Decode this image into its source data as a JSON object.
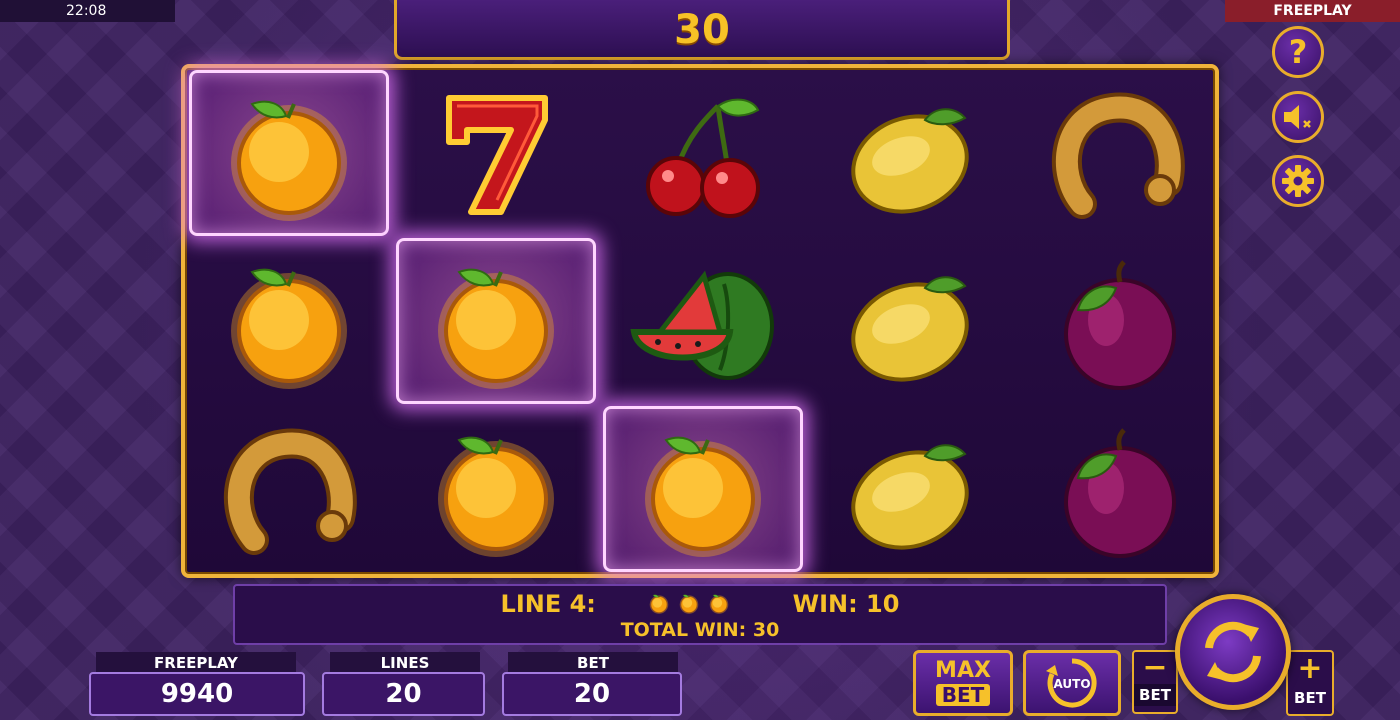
{
  "status": {
    "time": "22:08",
    "mode": "FREEPLAY"
  },
  "top_win": "30",
  "reels": [
    [
      "orange",
      "seven",
      "cherry",
      "lemon",
      "horseshoe"
    ],
    [
      "orange",
      "orange",
      "watermelon",
      "lemon",
      "plum"
    ],
    [
      "horseshoe",
      "orange",
      "orange",
      "lemon",
      "plum"
    ]
  ],
  "winning_cells": [
    [
      0,
      0
    ],
    [
      1,
      1
    ],
    [
      2,
      2
    ]
  ],
  "info": {
    "line_label": "LINE 4:",
    "win_label": "WIN: 10",
    "total_label": "TOTAL WIN: 30",
    "line_symbols": [
      "orange",
      "orange",
      "orange"
    ]
  },
  "stats": {
    "balance_label": "FREEPLAY",
    "balance_value": "9940",
    "lines_label": "LINES",
    "lines_value": "20",
    "bet_label": "BET",
    "bet_value": "20"
  },
  "buttons": {
    "max_top": "MAX",
    "max_bottom": "BET",
    "auto": "AUTO",
    "bet_minus_label": "BET",
    "bet_plus_label": "BET"
  },
  "icons": {
    "help": "help-icon",
    "sound": "sound-muted-icon",
    "settings": "gear-icon"
  },
  "colors": {
    "gold": "#f6c12a",
    "frame": "#f0b43a",
    "background": "#3f2363",
    "highlight": "#ffd6ff"
  }
}
